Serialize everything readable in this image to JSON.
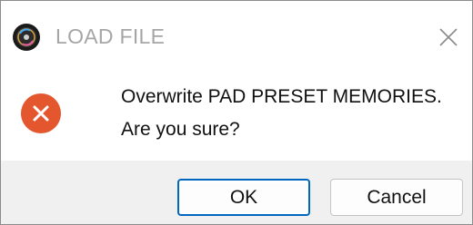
{
  "window": {
    "title": "LOAD FILE",
    "app_icon": "app-disc-icon",
    "close_icon": "close-icon"
  },
  "dialog": {
    "icon": "error-icon",
    "message_line1": "Overwrite PAD PRESET MEMORIES.",
    "message_line2": "Are you sure?"
  },
  "buttons": {
    "ok_label": "OK",
    "cancel_label": "Cancel"
  },
  "colors": {
    "error_accent": "#e4572e",
    "default_button_border": "#0067c0",
    "footer_bg": "#f0f0f0",
    "title_text": "#a6a6a6"
  }
}
